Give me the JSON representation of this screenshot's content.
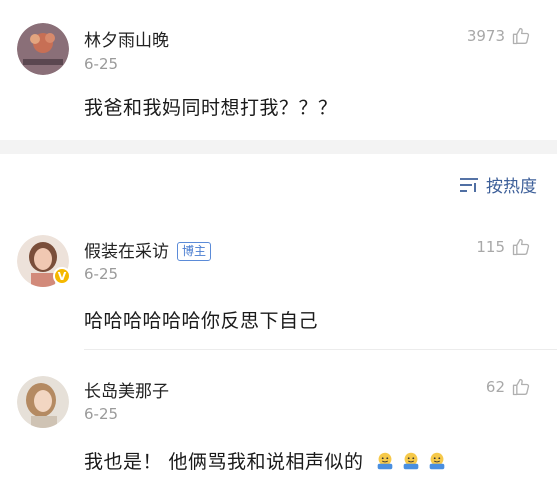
{
  "comments_top": [
    {
      "name": "林夕雨山晚",
      "date": "6-25",
      "likes": "3973",
      "text": "我爸和我妈同时想打我？？？"
    }
  ],
  "sort": {
    "label": "按热度",
    "icon": "sort-lines-icon"
  },
  "comments": [
    {
      "name": "假装在采访",
      "badge": "博主",
      "date": "6-25",
      "likes": "115",
      "text": "哈哈哈哈哈哈你反思下自己"
    },
    {
      "name": "长岛美那子",
      "date": "6-25",
      "likes": "62",
      "text": "我也是！ 他俩骂我和说相声似的"
    }
  ],
  "icons": {
    "like": "thumbs-up-icon",
    "verified": "verified-v-icon",
    "emoji": "shrug-emoji-icon"
  },
  "colors": {
    "accent": "#3d5f99",
    "badge": "#4a7dd0",
    "verified": "#f5b800"
  }
}
